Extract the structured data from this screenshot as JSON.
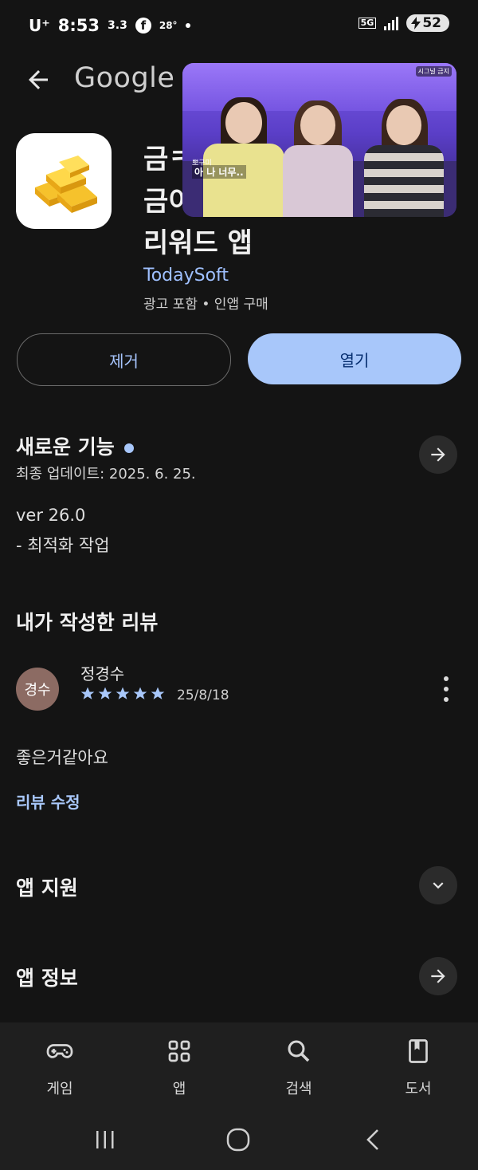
{
  "status_bar": {
    "carrier": "U⁺",
    "time": "8:53",
    "speed": "3.3",
    "facebook_glyph": "f",
    "temperature": "28°",
    "network": "5G",
    "battery": "52"
  },
  "header": {
    "title": "Google Pl",
    "back_icon": "arrow-left-icon"
  },
  "video_overlay": {
    "subtitle_small": "뽀구미",
    "subtitle_big": "아 나 너무..",
    "badge": "시그널 금지"
  },
  "app": {
    "name_line1": "금ㅋ",
    "name_line2": "금이",
    "name_line3": "리워드 앱",
    "developer": "TodaySoft",
    "meta": "광고 포함 • 인앱 구매",
    "buttons": {
      "remove": "제거",
      "open": "열기"
    }
  },
  "whats_new": {
    "title": "새로운 기능",
    "updated": "최종 업데이트: 2025. 6. 25.",
    "version": "ver 26.0",
    "notes": "- 최적화 작업"
  },
  "my_review": {
    "title": "내가 작성한 리뷰",
    "avatar_text": "경수",
    "name": "정경수",
    "stars": 5,
    "date": "25/8/18",
    "body": "좋은거같아요",
    "edit_link": "리뷰 수정"
  },
  "sections": {
    "app_support": "앱 지원",
    "about_app": "앱 정보"
  },
  "bottom_nav": [
    {
      "label": "게임",
      "icon": "gamepad-icon"
    },
    {
      "label": "앱",
      "icon": "apps-grid-icon"
    },
    {
      "label": "검색",
      "icon": "search-icon"
    },
    {
      "label": "도서",
      "icon": "book-icon"
    }
  ],
  "colors": {
    "background": "#141414",
    "accent": "#a8c7fa",
    "button_text_dark": "#062e6f",
    "nav_bg": "#1f1f1f"
  }
}
